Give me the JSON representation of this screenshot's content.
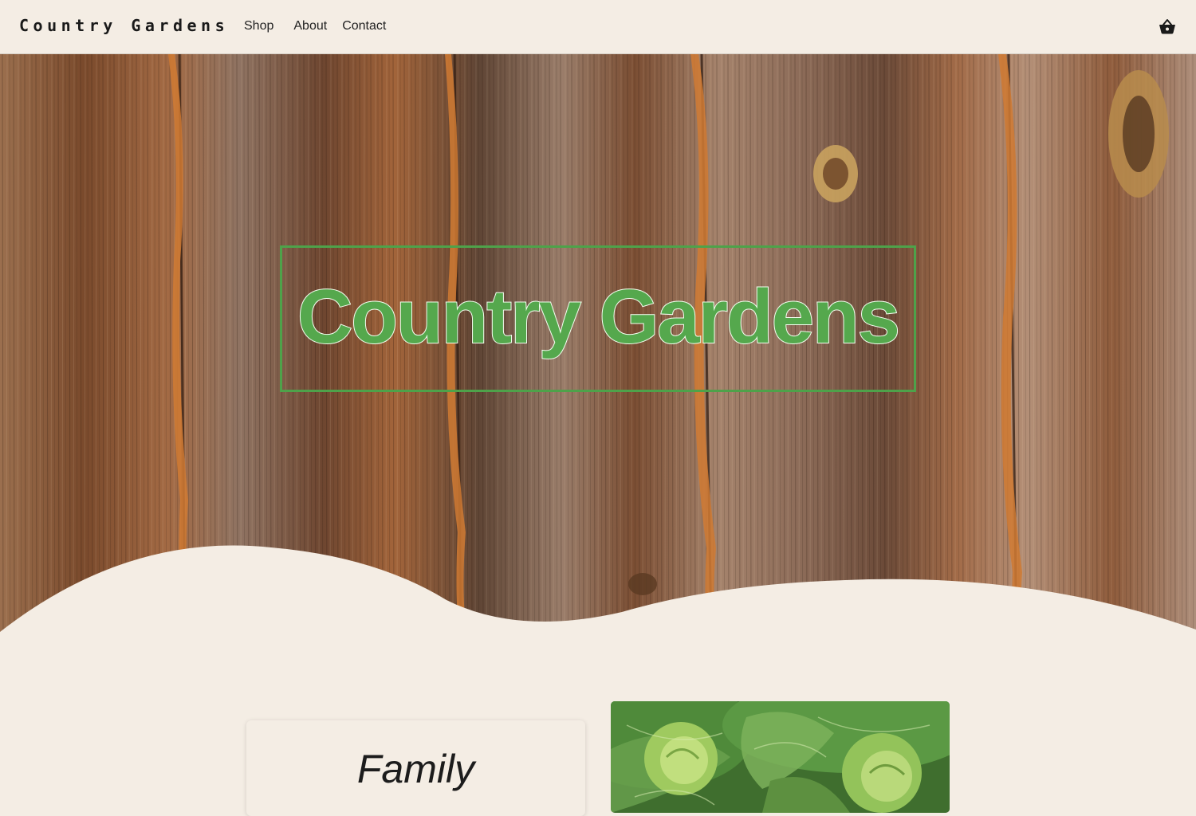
{
  "header": {
    "brand": "Country Gardens",
    "nav": [
      {
        "label": "Shop"
      },
      {
        "label": "About"
      },
      {
        "label": "Contact"
      }
    ],
    "cart_icon": "shopping-basket-icon"
  },
  "hero": {
    "title": "Country Gardens",
    "background": "weathered wooden planks"
  },
  "intro": {
    "card_title": "Family"
  },
  "colors": {
    "background": "#f4ede4",
    "accent_green": "#55a84d",
    "text": "#1a1a1a"
  }
}
